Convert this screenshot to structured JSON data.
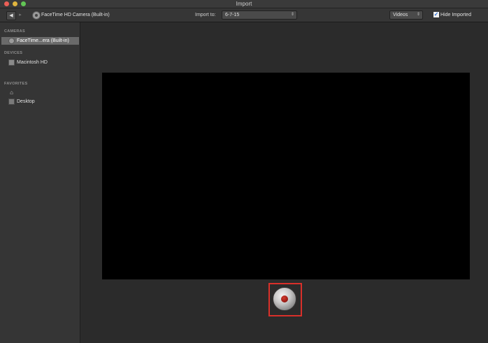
{
  "window": {
    "title": "Import"
  },
  "toolbar": {
    "back_label": "◀",
    "forward_label": "▸",
    "camera_name": "FaceTime HD Camera (Built-in)",
    "import_to_label": "Import to:",
    "event_value": "6-7-15",
    "media_value": "Videos",
    "hide_imported_label": "Hide Imported",
    "hide_imported_checked": true,
    "checkmark": "✓",
    "select_arrows": "⇕"
  },
  "sidebar": {
    "sections": [
      {
        "title": "CAMERAS",
        "items": [
          {
            "label": "FaceTime...era (Built-in)",
            "icon": "camera-icon",
            "selected": true
          }
        ]
      },
      {
        "title": "DEVICES",
        "items": [
          {
            "label": "Macintosh HD",
            "icon": "hard-drive-icon",
            "selected": false
          }
        ]
      },
      {
        "title": "FAVORITES",
        "items": [
          {
            "label": "",
            "icon": "home-icon",
            "selected": false
          },
          {
            "label": "Desktop",
            "icon": "desktop-icon",
            "selected": false
          }
        ]
      }
    ],
    "home_glyph": "⌂"
  },
  "main": {
    "record_button": {
      "icon": "record-icon",
      "highlight_color": "#d9302a"
    }
  }
}
